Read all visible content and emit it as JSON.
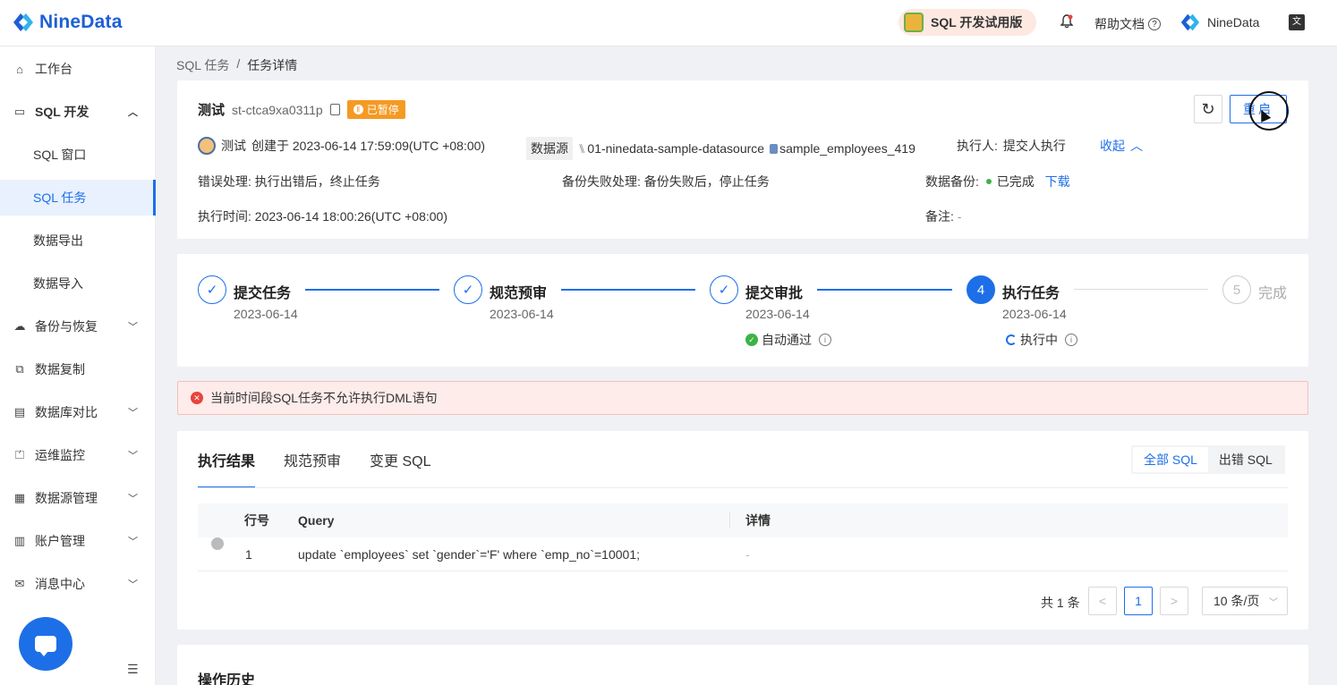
{
  "topbar": {
    "logo_text": "NineData",
    "trial_label": "SQL 开发试用版",
    "help_label": "帮助文档",
    "user_name": "NineData",
    "lang_icon": "文"
  },
  "sidebar": {
    "items": [
      {
        "label": "工作台",
        "icon": "home-icon"
      },
      {
        "label": "SQL 开发",
        "icon": "sql-dev-icon"
      },
      {
        "label": "SQL 窗口"
      },
      {
        "label": "SQL 任务"
      },
      {
        "label": "数据导出"
      },
      {
        "label": "数据导入"
      },
      {
        "label": "备份与恢复",
        "icon": "cloud-icon"
      },
      {
        "label": "数据复制",
        "icon": "copy-data-icon"
      },
      {
        "label": "数据库对比",
        "icon": "compare-icon"
      },
      {
        "label": "运维监控",
        "icon": "monitor-icon"
      },
      {
        "label": "数据源管理",
        "icon": "datasource-icon"
      },
      {
        "label": "账户管理",
        "icon": "account-icon"
      },
      {
        "label": "消息中心",
        "icon": "mail-icon"
      }
    ]
  },
  "breadcrumb": {
    "parent": "SQL 任务",
    "sep": "/",
    "current": "任务详情"
  },
  "task": {
    "title": "测试",
    "id": "st-ctca9xa0311p",
    "status": "已暂停",
    "refresh_icon": "↻",
    "restart_label": "重启",
    "creator": "测试",
    "created_text": "创建于 2023-06-14 17:59:09(UTC +08:00)",
    "ds_label": "数据源",
    "datasource": "01-ninedata-sample-datasource",
    "database": "sample_employees_419",
    "executor_label": "执行人:",
    "executor": "提交人执行",
    "collapse_label": "收起",
    "error_handling_label": "错误处理:",
    "error_handling": "执行出错后，终止任务",
    "backup_fail_label": "备份失败处理:",
    "backup_fail": "备份失败后，停止任务",
    "backup_label": "数据备份:",
    "backup_status": "已完成",
    "download_label": "下载",
    "exec_time_label": "执行时间:",
    "exec_time": "2023-06-14 18:00:26(UTC +08:00)",
    "remark_label": "备注:",
    "remark": "-"
  },
  "steps": [
    {
      "title": "提交任务",
      "date": "2023-06-14",
      "state": "done",
      "mark": "✓"
    },
    {
      "title": "规范预审",
      "date": "2023-06-14",
      "state": "done",
      "mark": "✓"
    },
    {
      "title": "提交审批",
      "date": "2023-06-14",
      "state": "done",
      "mark": "✓",
      "status": "自动通过"
    },
    {
      "title": "执行任务",
      "date": "2023-06-14",
      "state": "current",
      "mark": "4",
      "status": "执行中"
    },
    {
      "title": "完成",
      "date": "",
      "state": "wait",
      "mark": "5"
    }
  ],
  "error_message": "当前时间段SQL任务不允许执行DML语句",
  "result": {
    "tabs": [
      "执行结果",
      "规范预审",
      "变更 SQL"
    ],
    "filter": [
      "全部 SQL",
      "出错 SQL"
    ],
    "columns": [
      "行号",
      "Query",
      "详情"
    ],
    "rows": [
      {
        "no": "1",
        "query": "update `employees` set `gender`='F' where `emp_no`=10001;",
        "detail": "-"
      }
    ],
    "total_text": "共 1 条",
    "prev": "<",
    "page": "1",
    "next": ">",
    "page_size": "10 条/页"
  },
  "history": {
    "title": "操作历史"
  }
}
